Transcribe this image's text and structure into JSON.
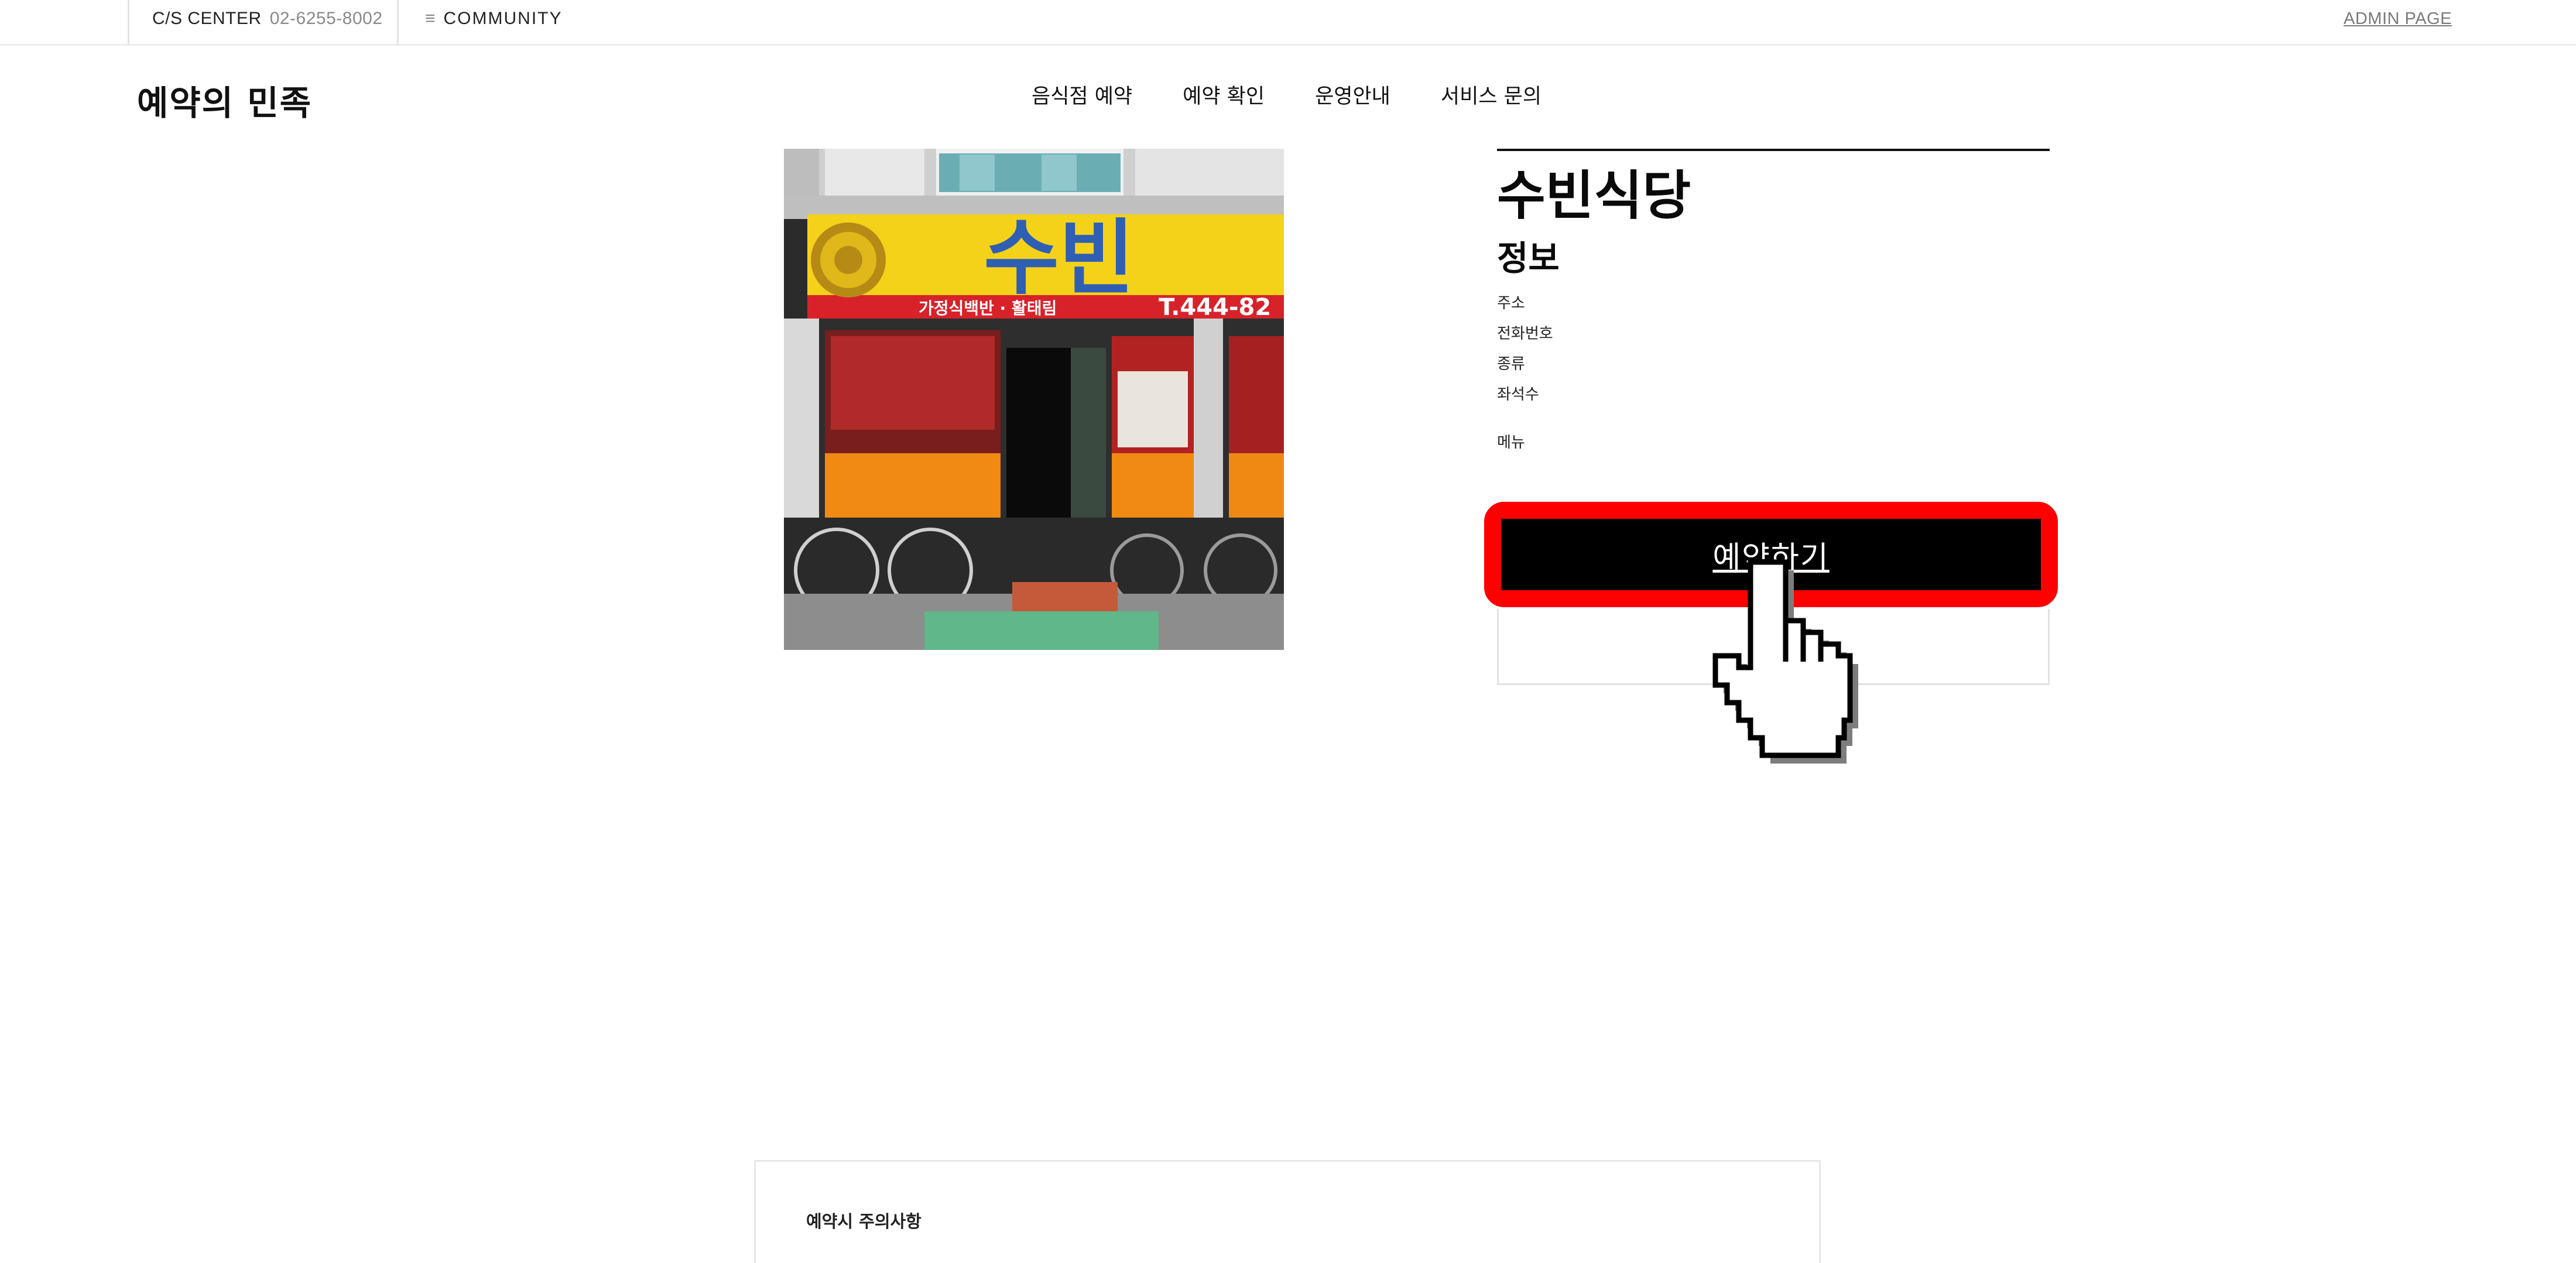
{
  "topbar": {
    "cs_label": "C/S CENTER",
    "cs_phone": "02-6255-8002",
    "community_icon": "≡",
    "community_label": "COMMUNITY",
    "admin_label": "ADMIN PAGE"
  },
  "header": {
    "logo": "예약의 민족",
    "nav": [
      "음식점 예약",
      "예약 확인",
      "운영안내",
      "서비스 문의"
    ]
  },
  "restaurant": {
    "name": "수빈식당",
    "info_title": "정보",
    "fields": [
      "주소",
      "전화번호",
      "종류",
      "좌석수"
    ],
    "menu_label": "메뉴",
    "book_button": "예약하기",
    "photo": {
      "sign_text": "수빈",
      "sign_sub": "가정식백반 · 활태림",
      "sign_phone": "T.444-82"
    }
  },
  "notice": {
    "title": "예약시 주의사항"
  },
  "icons": {
    "cursor": "hand-pointer-icon",
    "menu": "hamburger-icon"
  },
  "colors": {
    "highlight": "#ff0000",
    "button_bg": "#000000",
    "sign_yellow": "#f4d21a",
    "sign_blue": "#2f5fb3"
  }
}
